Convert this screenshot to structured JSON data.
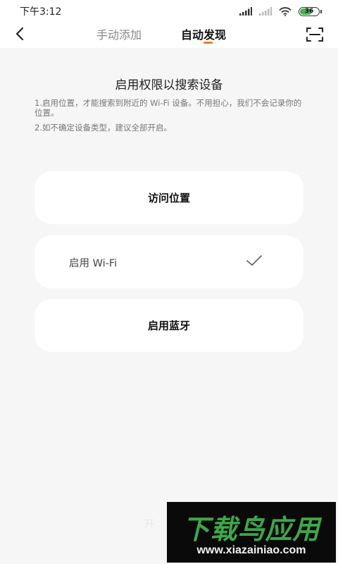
{
  "status_bar": {
    "time": "下午3:12",
    "battery": "36"
  },
  "nav": {
    "tabs": [
      {
        "label": "手动添加",
        "active": false
      },
      {
        "label": "自动发现",
        "active": true
      }
    ],
    "accent_color": "#f07a1e"
  },
  "main": {
    "title": "启用权限以搜索设备",
    "descriptions": [
      "1.启用位置，才能搜索到附近的 Wi-Fi 设备。不用担心，我们不会记录你的位置。",
      "2.如不确定设备类型，建议全部开启。"
    ],
    "permissions": [
      {
        "label": "访问位置",
        "granted": false
      },
      {
        "label": "启用 Wi-Fi",
        "granted": true,
        "icon": "check-icon"
      },
      {
        "label": "启用蓝牙",
        "granted": false
      }
    ],
    "bottom_hint": "开"
  },
  "watermark": {
    "title": "下载鸟应用",
    "url": "www.xiazainiao.com"
  }
}
